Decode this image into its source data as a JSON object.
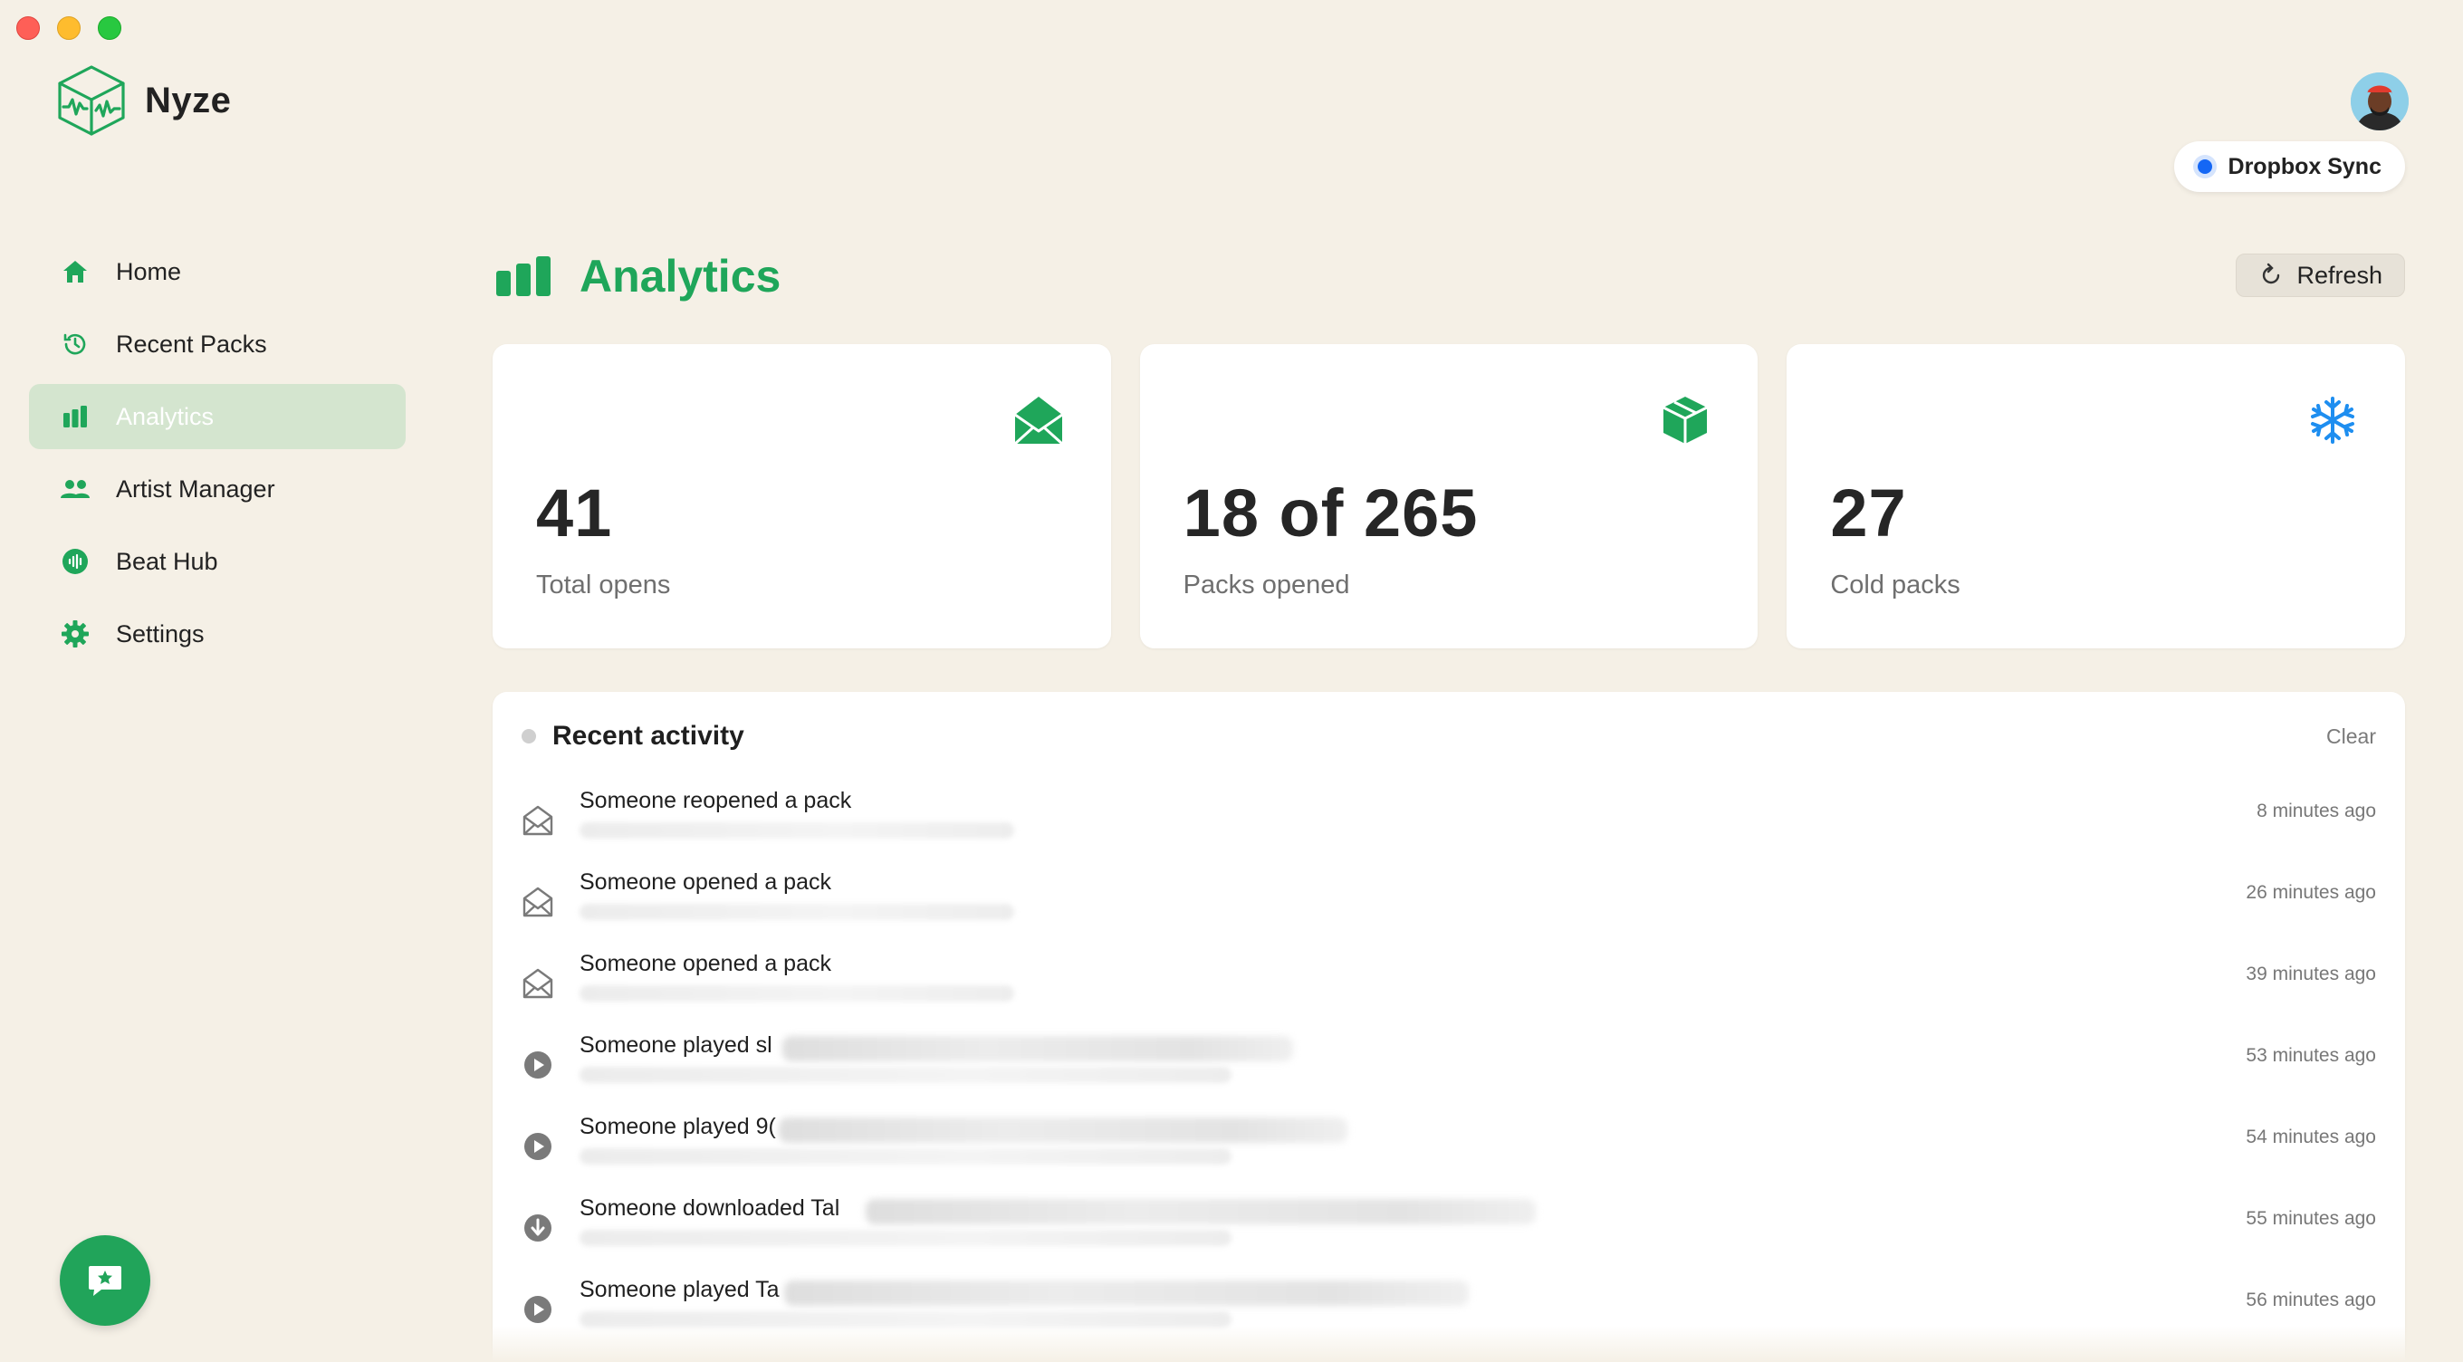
{
  "app": {
    "name": "Nyze"
  },
  "sync": {
    "label": "Dropbox Sync",
    "status_color": "#1467f5"
  },
  "colors": {
    "accent": "#1fa65a",
    "background": "#f5f0e6",
    "sidebar_active": "#d4e5cf",
    "info_blue": "#1e8ef0"
  },
  "sidebar": {
    "items": [
      {
        "label": "Home",
        "icon": "home-icon",
        "active": false
      },
      {
        "label": "Recent Packs",
        "icon": "history-icon",
        "active": false
      },
      {
        "label": "Analytics",
        "icon": "bar-chart-icon",
        "active": true
      },
      {
        "label": "Artist Manager",
        "icon": "users-icon",
        "active": false
      },
      {
        "label": "Beat Hub",
        "icon": "audio-wave-icon",
        "active": false
      },
      {
        "label": "Settings",
        "icon": "gear-icon",
        "active": false
      }
    ]
  },
  "header": {
    "title": "Analytics",
    "refresh_label": "Refresh"
  },
  "stats": [
    {
      "value": "41",
      "label": "Total opens",
      "icon": "open-envelope-icon"
    },
    {
      "value": "18 of 265",
      "label": "Packs opened",
      "icon": "cube-icon"
    },
    {
      "value": "27",
      "label": "Cold packs",
      "icon": "snowflake-icon"
    }
  ],
  "activity": {
    "title": "Recent activity",
    "clear_label": "Clear",
    "items": [
      {
        "text": "Someone reopened a pack",
        "time": "8 minutes ago",
        "icon": "open-envelope-icon"
      },
      {
        "text": "Someone opened a pack",
        "time": "26 minutes ago",
        "icon": "open-envelope-icon"
      },
      {
        "text": "Someone opened a pack",
        "time": "39 minutes ago",
        "icon": "open-envelope-icon"
      },
      {
        "text": "Someone played sl",
        "time": "53 minutes ago",
        "icon": "play-circle-icon"
      },
      {
        "text": "Someone played 9(",
        "time": "54 minutes ago",
        "icon": "play-circle-icon"
      },
      {
        "text": "Someone downloaded Tal",
        "time": "55 minutes ago",
        "icon": "download-circle-icon"
      },
      {
        "text": "Someone played Ta",
        "time": "56 minutes ago",
        "icon": "play-circle-icon"
      }
    ]
  }
}
